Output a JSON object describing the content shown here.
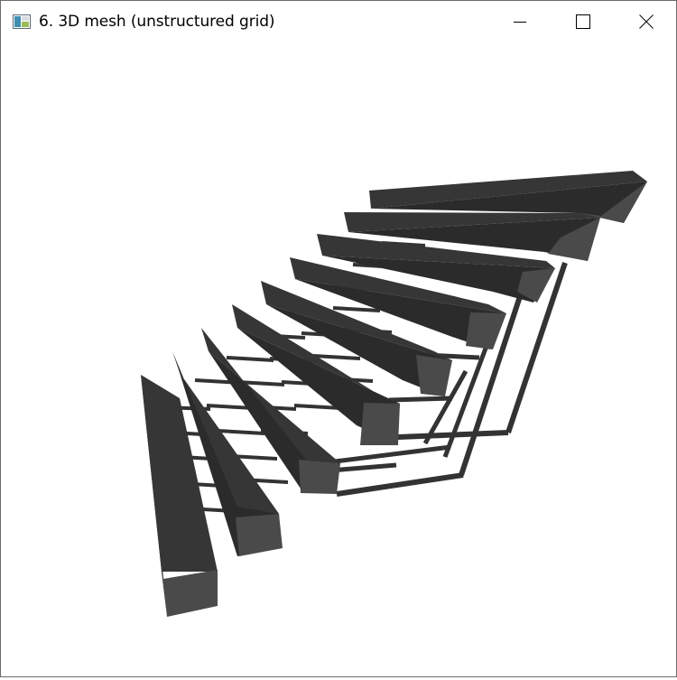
{
  "window": {
    "title": "6. 3D mesh (unstructured grid)",
    "icon": "app-window-icon",
    "controls": {
      "minimize": "minimize-icon",
      "maximize": "maximize-icon",
      "close": "close-icon"
    }
  },
  "scene": {
    "content": "3D staircase mesh",
    "background": "#ffffff",
    "colors": {
      "top": "#363636",
      "side": "#2b2b2b",
      "end": "#4a4a4a",
      "rail": "#333333"
    }
  }
}
